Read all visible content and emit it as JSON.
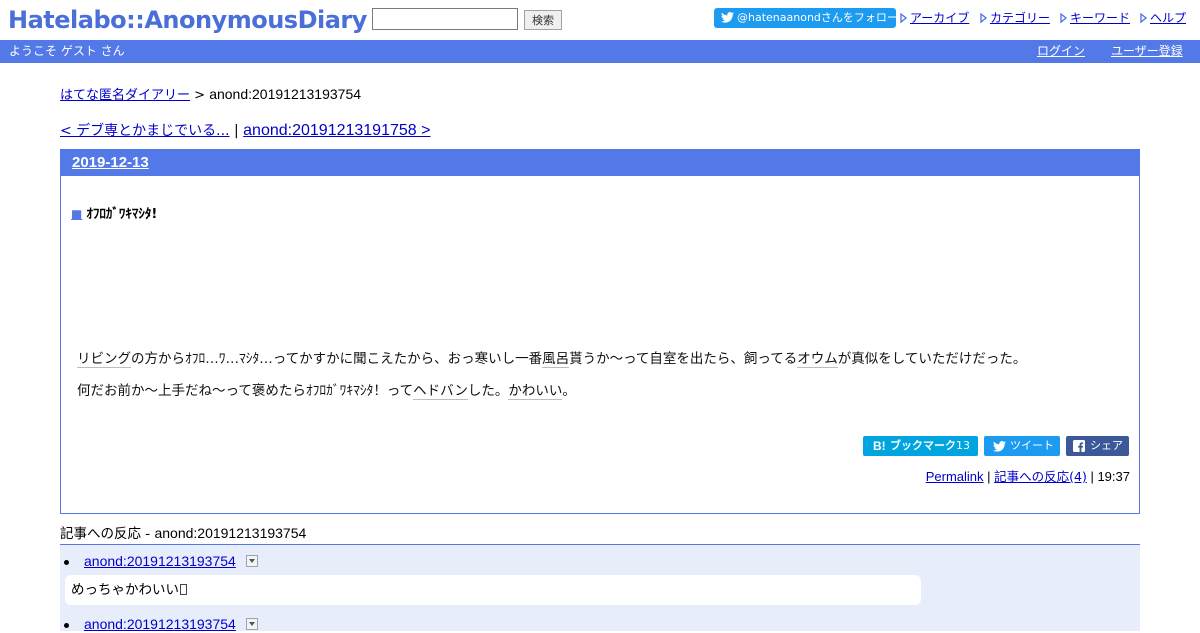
{
  "header": {
    "logo": "Hatelabo::AnonymousDiary",
    "search": {
      "value": "",
      "button_label": "検索"
    },
    "twitter_follow": "@hatenaanondさんをフォロー",
    "nav": [
      "アーカイブ",
      "カテゴリー",
      "キーワード",
      "ヘルプ"
    ]
  },
  "bar": {
    "welcome": "ようこそ ゲスト さん",
    "login": "ログイン",
    "register": "ユーザー登録"
  },
  "breadcrumb": {
    "home": "はてな匿名ダイアリー",
    "separator": " > ",
    "current": "anond:20191213193754"
  },
  "prevnext": {
    "prev": "< デブ専とかまじでいる...",
    "separator": " | ",
    "next": "anond:20191213191758 >"
  },
  "day": {
    "date": "2019-12-13",
    "entry": {
      "square": "■",
      "title": "ｵﾌﾛｶﾞﾜｷﾏｼﾀ!",
      "line1": {
        "k1": "リビング",
        "t1": "の方からｵﾌﾛ…ﾜ…ﾏｼﾀ…ってかすかに聞こえたから、おっ寒いし一番",
        "k2": "風呂",
        "t2": "貰うか〜って自室を出たら、飼ってる",
        "k3": "オウム",
        "t3": "が真似をしていただけだった。"
      },
      "line2": {
        "t1": "何だお前か〜上手だね〜って褒めたらｵﾌﾛｶﾞﾜｷﾏｼﾀ！って",
        "k1": "ヘドバン",
        "t2": "した。",
        "k2": "かわいい",
        "t3": "。"
      }
    },
    "share": {
      "bookmark_label": "ブックマーク",
      "bookmark_count": "13",
      "tweet_label": "ツイート",
      "share_label": "シェア"
    },
    "meta": {
      "permalink": "Permalink",
      "sep": " | ",
      "reactions": "記事への反応(4)",
      "time": "19:37"
    }
  },
  "reactions": {
    "title": "記事への反応 - ",
    "title_id": "anond:20191213193754",
    "items": [
      {
        "link": "anond:20191213193754",
        "body": "めっちゃかわいい"
      },
      {
        "link": "anond:20191213193754",
        "body": ""
      }
    ]
  },
  "colors": {
    "brand": "#5279e7",
    "logo": "#4a6fd8",
    "link": "#0000cc",
    "twitter": "#1d9bf0",
    "hatena_bookmark": "#00a4de",
    "facebook": "#3b5998",
    "reaction_bg": "#e8edfc"
  },
  "icons": {
    "twitter": "twitter-bird-icon",
    "nav_marker": "triangle-marker-icon",
    "bookmark": "hatena-b-icon",
    "facebook": "facebook-f-icon",
    "toggle": "chevron-down-icon"
  }
}
